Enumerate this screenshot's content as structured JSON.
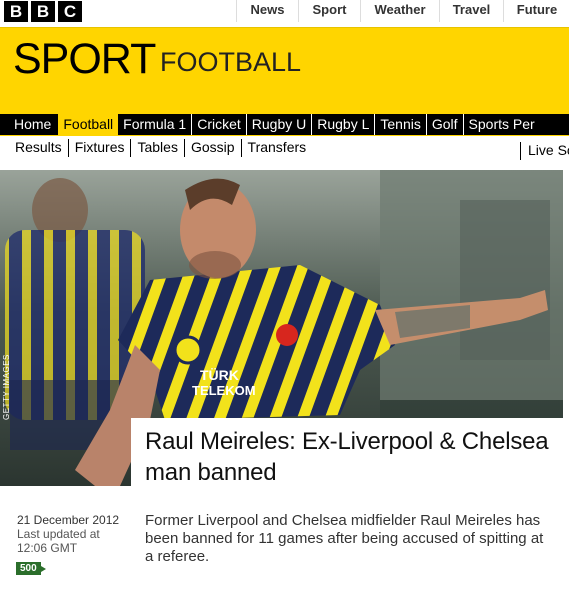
{
  "bbc_logo": [
    "B",
    "B",
    "C"
  ],
  "top_nav": [
    "News",
    "Sport",
    "Weather",
    "Travel",
    "Future"
  ],
  "header": {
    "title": "SPORT",
    "section": "FOOTBALL"
  },
  "main_nav": [
    "Home",
    "Football",
    "Formula 1",
    "Cricket",
    "Rugby U",
    "Rugby L",
    "Tennis",
    "Golf",
    "Sports Per"
  ],
  "sub_nav": [
    "Results",
    "Fixtures",
    "Tables",
    "Gossip",
    "Transfers"
  ],
  "sub_nav_live": "Live Sc",
  "photo": {
    "credit": "GETTY IMAGES",
    "shirt_text": [
      "TÜRK",
      "TELEKOM"
    ]
  },
  "article": {
    "headline": "Raul Meireles: Ex-Liverpool & Chelsea man banned",
    "date": "21 December 2012",
    "updated_label": "Last updated at",
    "updated_time": "12:06 GMT",
    "shares": "500",
    "summary": "Former Liverpool and Chelsea midfielder Raul Meireles has been banned for 11 games after being accused of spitting at a referee."
  },
  "colors": {
    "accent": "#ffd500",
    "nav_bg": "#000000",
    "shares_badge": "#2b6e2b"
  }
}
